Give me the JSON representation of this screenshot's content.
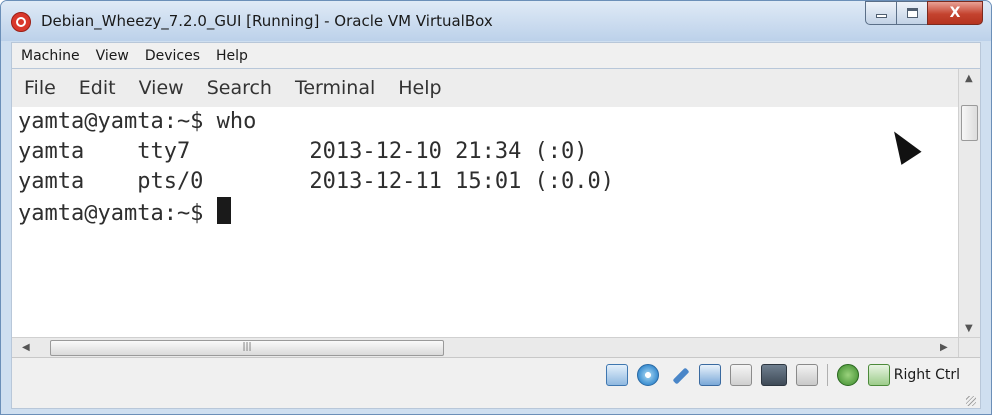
{
  "window": {
    "title": "Debian_Wheezy_7.2.0_GUI [Running] - Oracle VM VirtualBox",
    "close_glyph": "X"
  },
  "vbox_menu": [
    "Machine",
    "View",
    "Devices",
    "Help"
  ],
  "terminal": {
    "menu": [
      "File",
      "Edit",
      "View",
      "Search",
      "Terminal",
      "Help"
    ],
    "lines": [
      "yamta@yamta:~$ who",
      "yamta    tty7         2013-12-10 21:34 (:0)",
      "yamta    pts/0        2013-12-11 15:01 (:0.0)"
    ],
    "prompt": "yamta@yamta:~$ "
  },
  "statusbar": {
    "host_key": "Right Ctrl"
  },
  "icons": [
    "app-icon",
    "minimize-icon",
    "maximize-icon",
    "close-icon",
    "network-icon",
    "optical-drive-icon",
    "usb-icon",
    "shared-folders-icon",
    "folder-icon",
    "video-capture-icon",
    "hard-disk-icon",
    "mouse-integration-icon",
    "keyboard-capture-icon",
    "mouse-pointer-icon"
  ]
}
